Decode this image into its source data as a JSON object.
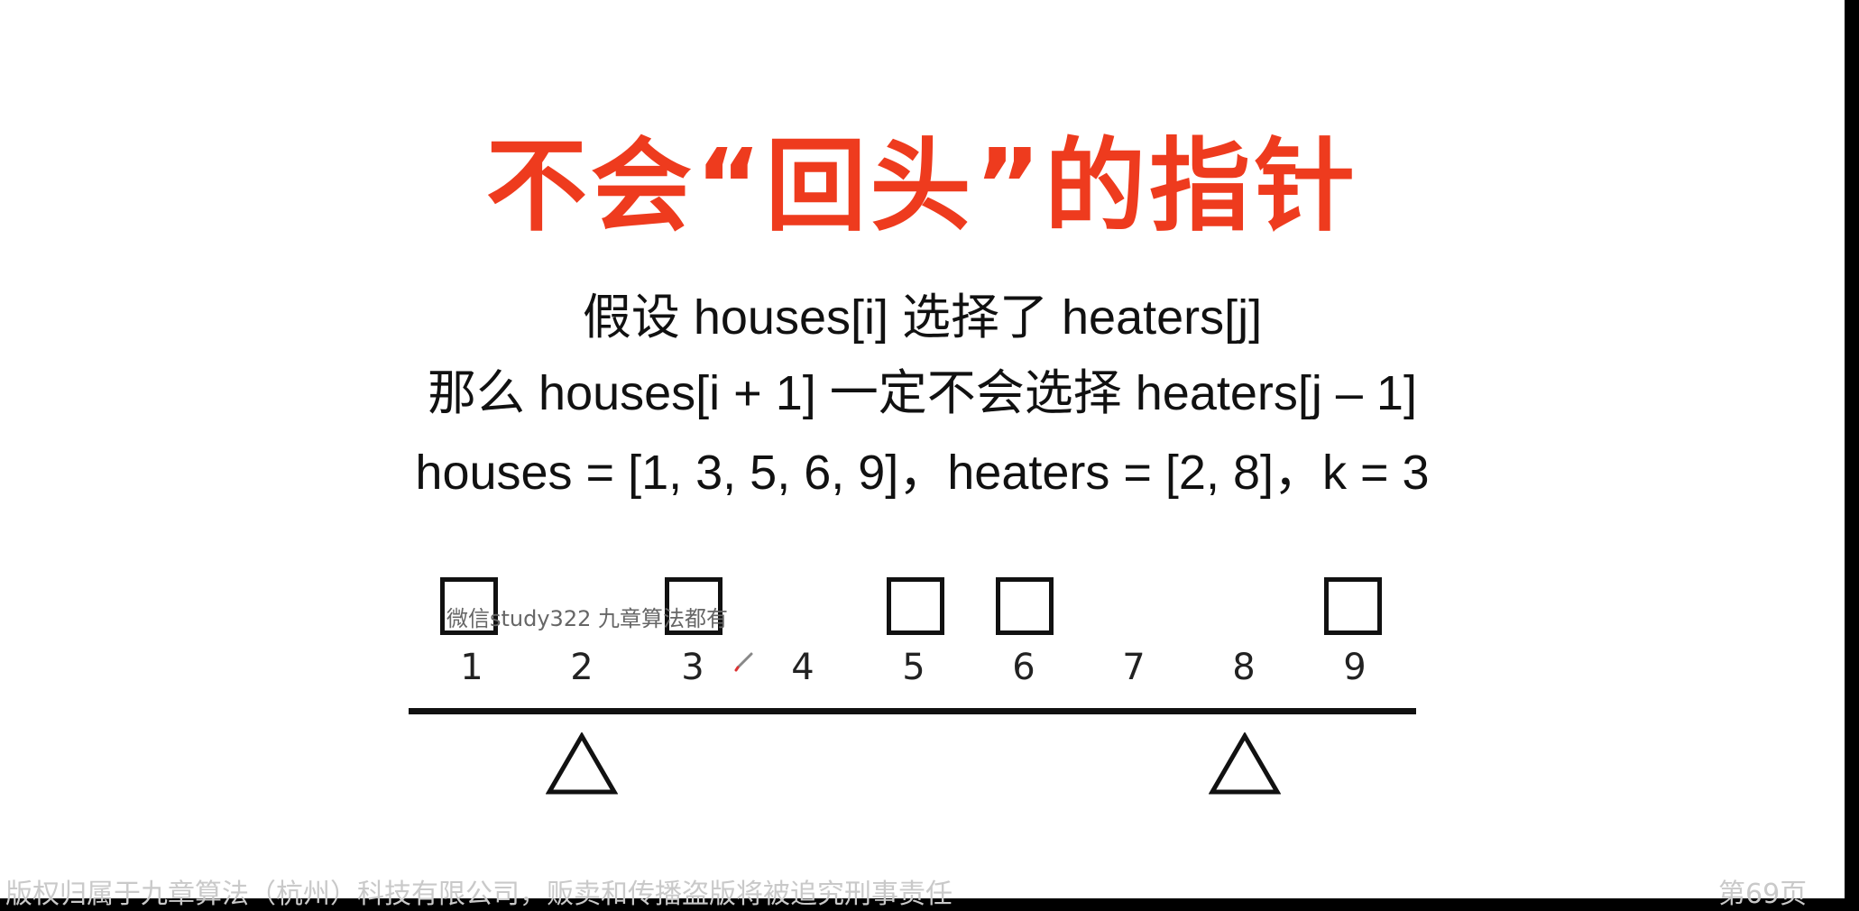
{
  "slide": {
    "title": "不会“回头”的指针",
    "lines": [
      "假设 houses[i] 选择了 heaters[j]",
      "那么 houses[i + 1] 一定不会选择 heaters[j – 1]",
      "houses = [1, 3, 5, 6, 9]，heaters = [2, 8]，k = 3"
    ],
    "number_line": [
      "1",
      "2",
      "3",
      "4",
      "5",
      "6",
      "7",
      "8",
      "9"
    ],
    "houses": [
      1,
      3,
      5,
      6,
      9
    ],
    "heaters": [
      2,
      8
    ],
    "watermark": "微信study322 九章算法都有",
    "footer_left": "版权归属于九章算法（杭州）科技有限公司，贩卖和传播盗版将被追究刑事责任",
    "footer_right": "第69页",
    "colors": {
      "title": "#ee3b1e",
      "text": "#111111",
      "background": "#ffffff"
    },
    "icons": {
      "house": "square-outline",
      "heater": "triangle-outline",
      "pen": "pen-cursor-icon"
    }
  }
}
